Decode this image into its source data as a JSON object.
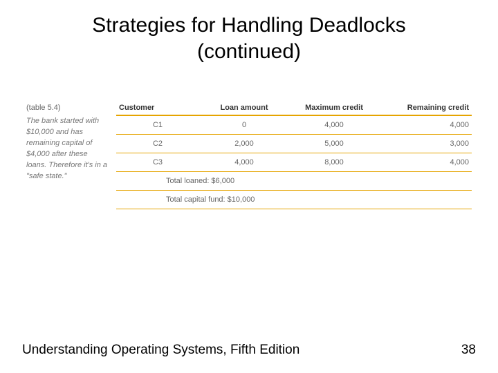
{
  "title_line1": "Strategies for Handling Deadlocks",
  "title_line2": "(continued)",
  "sidebar": {
    "label": "(table 5.4)",
    "caption": "The bank started with $10,000 and has remaining capital of $4,000 after these loans. Therefore it's in a \"safe state.\""
  },
  "table": {
    "headers": {
      "customer": "Customer",
      "loan": "Loan amount",
      "max": "Maximum credit",
      "remain": "Remaining credit"
    },
    "rows": [
      {
        "customer": "C1",
        "loan": "0",
        "max": "4,000",
        "remain": "4,000"
      },
      {
        "customer": "C2",
        "loan": "2,000",
        "max": "5,000",
        "remain": "3,000"
      },
      {
        "customer": "C3",
        "loan": "4,000",
        "max": "8,000",
        "remain": "4,000"
      }
    ],
    "summary1": "Total loaned: $6,000",
    "summary2": "Total capital fund: $10,000"
  },
  "footer": {
    "book": "Understanding Operating Systems, Fifth Edition",
    "page": "38"
  }
}
